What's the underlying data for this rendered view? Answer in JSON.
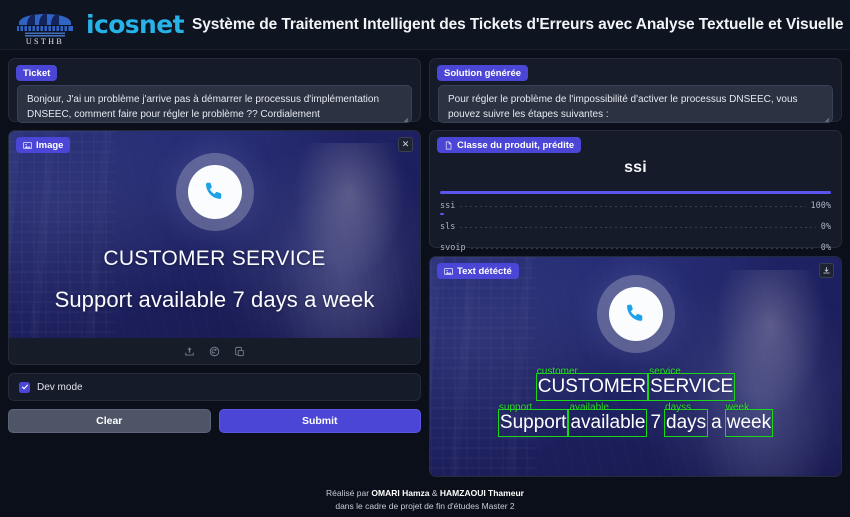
{
  "header": {
    "brand": "icosnet",
    "logo_text": "USTHB",
    "logo_icon": "usthb-dome-logo",
    "title": "Système de Traitement Intelligent des Tickets d'Erreurs avec Analyse Textuelle et Visuelle"
  },
  "ticket": {
    "badge": "Ticket",
    "value": "Bonjour, J'ai un problème j'arrive pas à démarrer le processus d'implémentation DNSEEC, comment faire pour régler le problème ?? Cordialement",
    "placeholder": "Ticket"
  },
  "solution": {
    "badge": "Solution générée",
    "value": "Pour régler le problème de l'impossibilité d'activer le processus DNSEEC, vous pouvez suivre les étapes suivantes :",
    "placeholder": "Solution générée"
  },
  "image_panel": {
    "badge": "Image",
    "badge_icon": "image-icon",
    "close_icon": "close-icon",
    "hero_icon": "phone-icon",
    "hero_line1": "CUSTOMER SERVICE",
    "hero_line2": "Support available 7 days a week",
    "tools": [
      {
        "name": "share-icon"
      },
      {
        "name": "undo-icon"
      },
      {
        "name": "copy-icon"
      }
    ]
  },
  "dev_mode": {
    "label": "Dev mode",
    "checked": true
  },
  "actions": {
    "clear_label": "Clear",
    "submit_label": "Submit"
  },
  "classification": {
    "badge": "Classe du produit, prédite",
    "badge_icon": "document-icon",
    "predicted": "ssi",
    "bar_color": "#5b54ee",
    "rows": [
      {
        "label": "ssi",
        "percent": "100%",
        "value": 100
      },
      {
        "label": "sls",
        "percent": "0%",
        "value": 0
      },
      {
        "label": "svoip",
        "percent": "0%",
        "value": 0
      }
    ]
  },
  "ocr_panel": {
    "badge": "Text détécté",
    "badge_icon": "image-icon",
    "download_icon": "download-icon",
    "box_color": "#18d818",
    "tag_color": "#2ee02e",
    "row1": [
      {
        "tag": "customer",
        "text": "CUSTOMER",
        "boxed": true
      },
      {
        "tag": "service",
        "text": "SERVICE",
        "boxed": true
      }
    ],
    "row2": [
      {
        "tag": "support",
        "text": "Support",
        "boxed": true
      },
      {
        "tag": "available",
        "text": "available",
        "boxed": true
      },
      {
        "tag": "",
        "text": "7",
        "boxed": false
      },
      {
        "tag": "dayss",
        "text": "days",
        "boxed": true
      },
      {
        "tag": "",
        "text": "a",
        "boxed": false
      },
      {
        "tag": "week",
        "text": "week",
        "boxed": true
      }
    ]
  },
  "footer": {
    "line1_prefix": "Réalisé par ",
    "author1": "OMARI Hamza",
    "line1_mid": " & ",
    "author2": "HAMZAOUI Thameur",
    "line2": "dans le cadre de projet de fin d'études Master 2"
  }
}
